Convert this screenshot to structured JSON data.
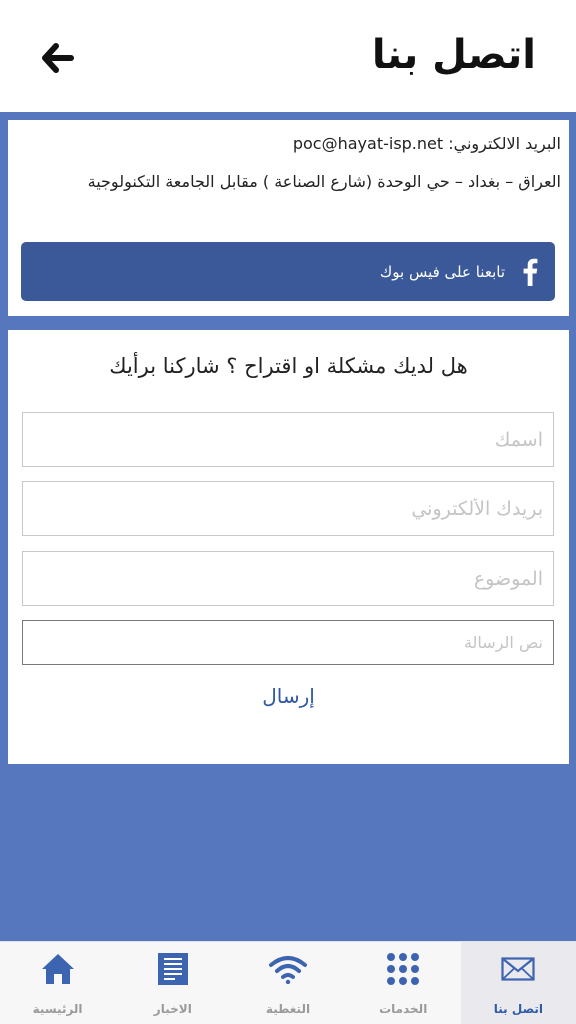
{
  "header": {
    "title": "اتصل بنا",
    "back_icon": "arrow-left-icon"
  },
  "info": {
    "email_line": "البريد الالكتروني: poc@hayat-isp.net",
    "address_line": "العراق – بغداد – حي الوحدة (شارع الصناعة ) مقابل الجامعة التكنولوجية",
    "facebook_label": "تابعنا على فيس بوك",
    "facebook_icon": "facebook-icon"
  },
  "form": {
    "title": "هل لديك مشكلة او اقتراح ؟ شاركنا برأيك",
    "name_placeholder": "اسمك",
    "email_placeholder": "بريدك الألكتروني",
    "subject_placeholder": "الموضوع",
    "message_placeholder": "نص الرسالة",
    "send_label": "إرسال"
  },
  "tabs": [
    {
      "label": "اتصل بنا",
      "icon": "mail-icon",
      "active": true
    },
    {
      "label": "الخدمات",
      "icon": "grid-icon",
      "active": false
    },
    {
      "label": "التغطية",
      "icon": "wifi-icon",
      "active": false
    },
    {
      "label": "الاخبار",
      "icon": "news-icon",
      "active": false
    },
    {
      "label": "الرئيسية",
      "icon": "home-icon",
      "active": false
    }
  ],
  "colors": {
    "background": "#5677bd",
    "facebook": "#3b5998",
    "accent": "#2f5aa6",
    "inactive_icon": "#3d64b0"
  }
}
